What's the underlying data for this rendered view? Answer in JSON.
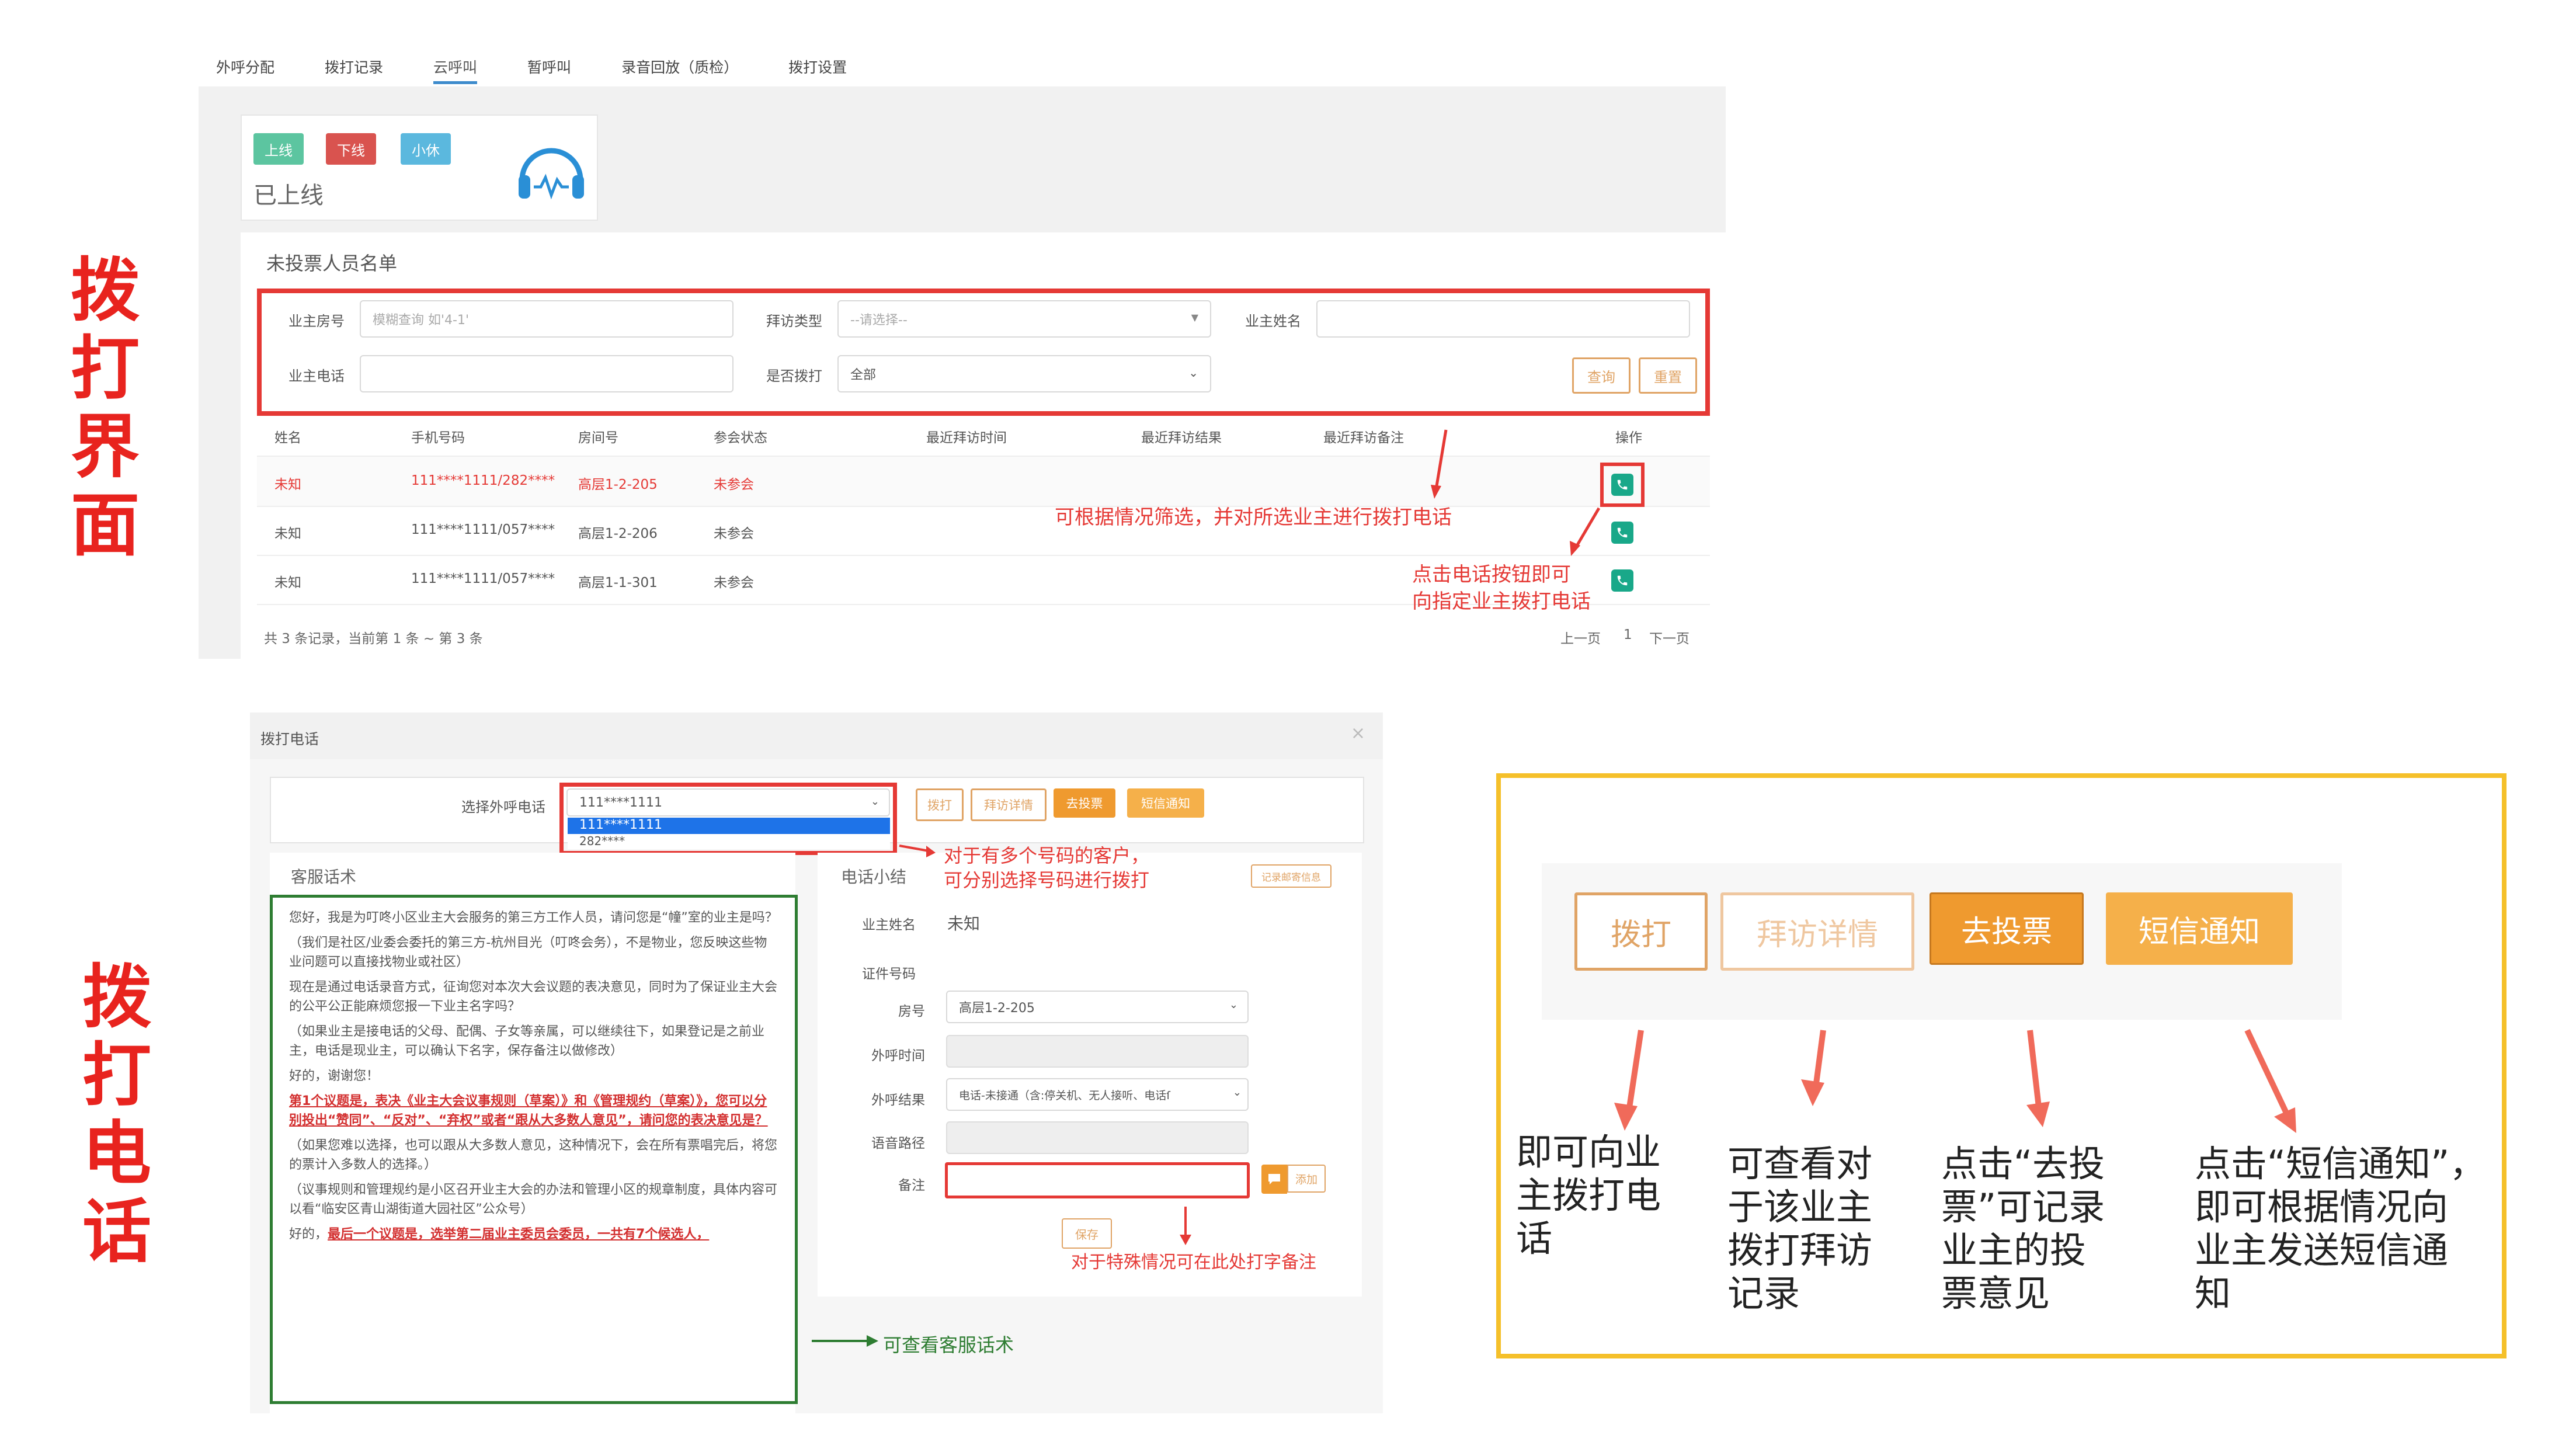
{
  "side_titles": {
    "top": [
      "拨",
      "打",
      "界",
      "面"
    ],
    "bottom": [
      "拨",
      "打",
      "电",
      "话"
    ]
  },
  "tabs": [
    {
      "label": "外呼分配"
    },
    {
      "label": "拨打记录"
    },
    {
      "label": "云呼叫",
      "active": true
    },
    {
      "label": "暂呼叫"
    },
    {
      "label": "录音回放（质检）"
    },
    {
      "label": "拨打设置"
    }
  ],
  "status_card": {
    "online": "上线",
    "offline": "下线",
    "rest": "小休",
    "status_text": "已上线",
    "icon": "headset-icon"
  },
  "list_panel": {
    "title": "未投票人员名单",
    "filters": {
      "room_label": "业主房号",
      "room_placeholder": "模糊查询 如'4-1'",
      "visit_type_label": "拜访类型",
      "visit_type_placeholder": "--请选择--",
      "owner_name_label": "业主姓名",
      "phone_label": "业主电话",
      "called_label": "是否拨打",
      "called_value": "全部",
      "search_btn": "查询",
      "reset_btn": "重置"
    },
    "columns": [
      "姓名",
      "手机号码",
      "房间号",
      "参会状态",
      "最近拜访时间",
      "最近拜访结果",
      "最近拜访备注",
      "操作"
    ],
    "rows": [
      {
        "name": "未知",
        "phone": "111****1111/282****",
        "room": "高层1-2-205",
        "status": "未参会"
      },
      {
        "name": "未知",
        "phone": "111****1111/057****",
        "room": "高层1-2-206",
        "status": "未参会"
      },
      {
        "name": "未知",
        "phone": "111****1111/057****",
        "room": "高层1-1-301",
        "status": "未参会"
      }
    ],
    "footer": "共 3 条记录，当前第 1 条 ~ 第 3 条",
    "pager": {
      "prev": "上一页",
      "page": "1",
      "next": "下一页"
    }
  },
  "annotations_top": {
    "filter_note": "可根据情况筛选，并对所选业主进行拨打电话",
    "call_note_1": "点击电话按钮即可",
    "call_note_2": "向指定业主拨打电话"
  },
  "dialog": {
    "title": "拨打电话",
    "close": "×",
    "select_label": "选择外呼电话",
    "select_value": "111****1111",
    "select_options": [
      "111****1111",
      "282****"
    ],
    "btn_call": "拨打",
    "btn_detail": "拜访详情",
    "btn_vote": "去投票",
    "btn_sms": "短信通知",
    "script_title": "客服话术",
    "summary_title": "电话小结",
    "record_tag": "记录邮寄信息",
    "form": {
      "owner_name_label": "业主姓名",
      "owner_name_value": "未知",
      "id_label": "证件号码",
      "room_label": "房号",
      "room_value": "高层1-2-205",
      "call_time_label": "外呼时间",
      "call_result_label": "外呼结果",
      "call_result_value": "电话-未接通（含:停关机、无人接听、电话ſ",
      "audio_label": "语音路径",
      "remark_label": "备注",
      "add_btn": "添加",
      "save_btn": "保存"
    },
    "script": {
      "p1": "您好，我是为叮咚小区业主大会服务的第三方工作人员，请问您是“幢”室的业主是吗？",
      "p2": "（我们是社区/业委会委托的第三方-杭州目光（叮咚会务），不是物业，您反映这些物业问题可以直接找物业或社区）",
      "p3": "现在是通过电话录音方式，征询您对本次大会议题的表决意见，同时为了保证业主大会的公平公正能麻烦您报一下业主名字吗？",
      "p4": "（如果业主是接电话的父母、配偶、子女等亲属，可以继续往下，如果登记是之前业主，电话是现业主，可以确认下名字，保存备注以做修改）",
      "p5": "好的，谢谢您！",
      "p6": "第1个议题是，表决《业主大会议事规则（草案）》和《管理规约（草案）》，您可以分别投出“赞同”、“反对”、“弃权”或者“跟从大多数人意见”，请问您的表决意见是？",
      "p7": "（如果您难以选择，也可以跟从大多数人意见，这种情况下，会在所有票唱完后，将您的票计入多数人的选择。）",
      "p8": "（议事规则和管理规约是小区召开业主大会的办法和管理小区的规章制度，具体内容可以看“临安区青山湖街道大园社区”公众号）",
      "p9a": "好的，",
      "p9b": "最后一个议题是，选举第二届业主委员会委员，一共有7个候选人，"
    }
  },
  "annotations_bottom": {
    "multi_number_1": "对于有多个号码的客户，",
    "multi_number_2": "可分别选择号码进行拨打",
    "remark_note": "对于特殊情况可在此处打字备注",
    "script_note": "可查看客服话术"
  },
  "zoom_panel": {
    "btn_call": "拨打",
    "btn_detail": "拜访详情",
    "btn_vote": "去投票",
    "btn_sms": "短信通知",
    "cap_call": [
      "即可向业",
      "主拨打电",
      "话"
    ],
    "cap_detail": [
      "可查看对",
      "于该业主",
      "拨打拜访",
      "记录"
    ],
    "cap_vote": [
      "点击“去投",
      "票”可记录",
      "业主的投",
      "票意见"
    ],
    "cap_sms": [
      "点击“短信通知”，",
      "即可根据情况向",
      "业主发送短信通",
      "知"
    ]
  },
  "colors": {
    "red": "#e53935",
    "green": "#2e7d32",
    "orange": "#ef9a2f",
    "gold_border": "#f5c02a",
    "teal": "#19a889"
  }
}
